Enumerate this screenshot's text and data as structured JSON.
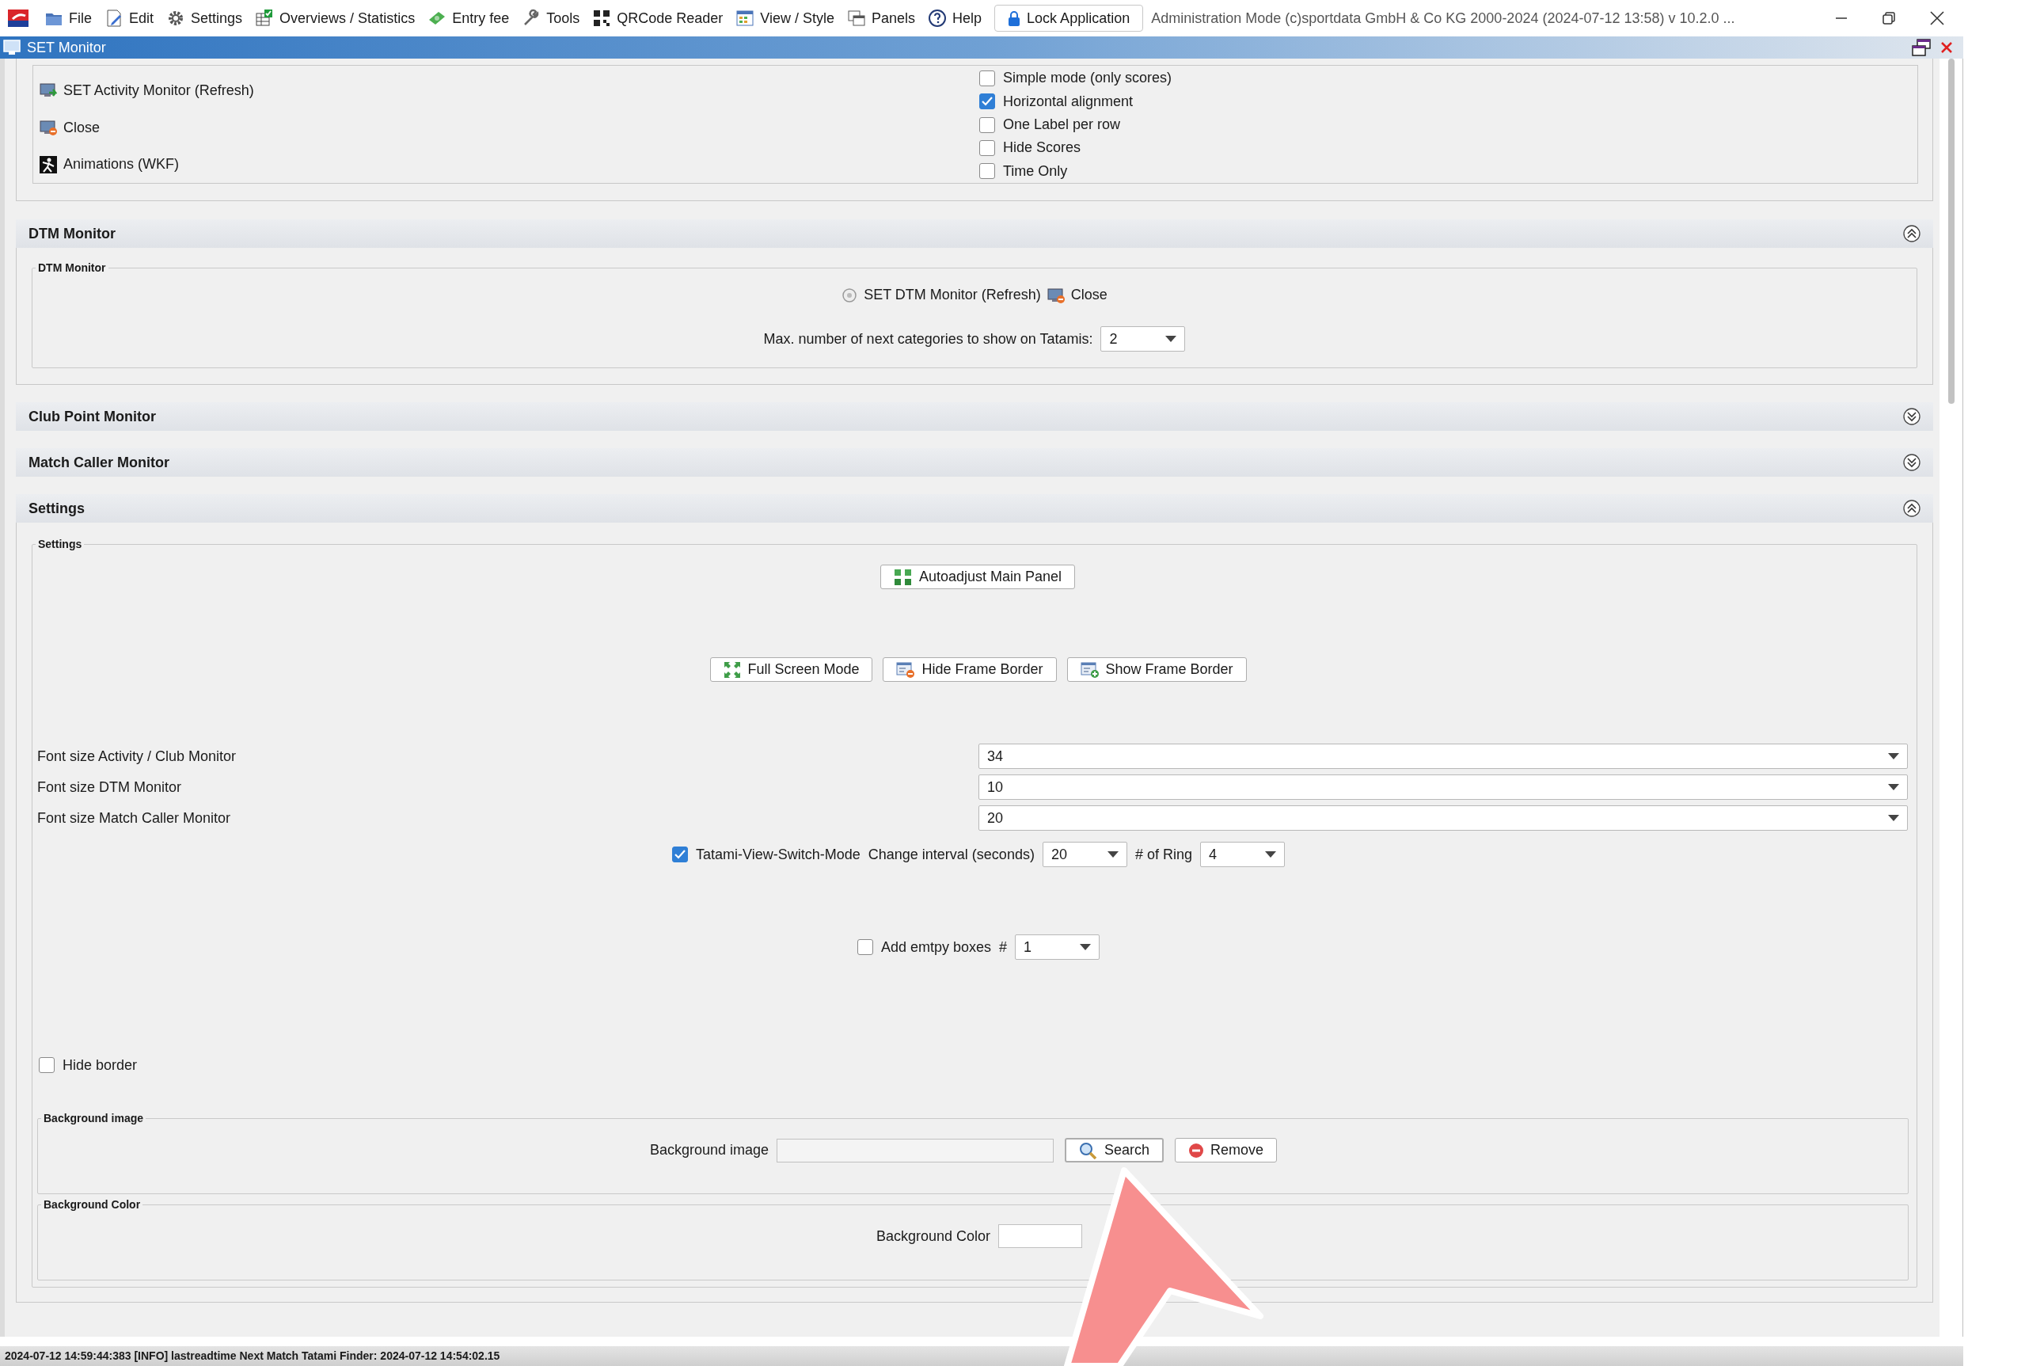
{
  "menu_bar": {
    "items": [
      {
        "label": "File"
      },
      {
        "label": "Edit"
      },
      {
        "label": "Settings"
      },
      {
        "label": "Overviews / Statistics"
      },
      {
        "label": "Entry fee"
      },
      {
        "label": "Tools"
      },
      {
        "label": "QRCode Reader"
      },
      {
        "label": "View / Style"
      },
      {
        "label": "Panels"
      },
      {
        "label": "Help"
      }
    ],
    "lock_button": "Lock Application",
    "title": "Administration Mode (c)sportdata GmbH & Co KG 2000-2024 (2024-07-12 13:58) v 10.2.0 ..."
  },
  "window": {
    "title": "SET Monitor"
  },
  "top_panel": {
    "actions": [
      {
        "label": "SET Activity Monitor (Refresh)"
      },
      {
        "label": "Close"
      },
      {
        "label": "Animations (WKF)"
      }
    ],
    "options": [
      {
        "label": "Simple mode (only scores)",
        "checked": false
      },
      {
        "label": "Horizontal alignment",
        "checked": true
      },
      {
        "label": "One Label per row",
        "checked": false
      },
      {
        "label": "Hide Scores",
        "checked": false
      },
      {
        "label": "Time Only",
        "checked": false
      }
    ]
  },
  "sections": [
    {
      "kind": "dtm",
      "title": "DTM Monitor",
      "expanded": true,
      "group_title": "DTM Monitor",
      "buttons": [
        "SET DTM Monitor (Refresh)",
        "Close"
      ],
      "categories_label": "Max. number of next categories to show on Tatamis:",
      "categories_value": "2"
    },
    {
      "title": "Club Point Monitor",
      "expanded": false
    },
    {
      "title": "Match Caller Monitor",
      "expanded": false
    },
    {
      "kind": "settings",
      "title": "Settings",
      "expanded": true,
      "group_title": "Settings",
      "autoadjust": "Autoadjust Main Panel",
      "frame_buttons": [
        "Full Screen Mode",
        "Hide Frame Border",
        "Show Frame Border"
      ],
      "font_sizes": [
        {
          "label": "Font size Activity / Club Monitor",
          "value": "34"
        },
        {
          "label": "Font size DTM Monitor",
          "value": "10"
        },
        {
          "label": "Font size Match Caller Monitor",
          "value": "20"
        }
      ],
      "tatami": {
        "label": "Tatami-View-Switch-Mode",
        "checked": true,
        "interval_label": "Change interval (seconds)",
        "interval_value": "20",
        "ring_label": "# of Ring",
        "ring_value": "4"
      },
      "empty_boxes": {
        "label": "Add emtpy boxes",
        "checked": false,
        "hash": "#",
        "value": "1"
      },
      "hide_border": {
        "label": "Hide border",
        "checked": false
      },
      "background_image": {
        "group_title": "Background image",
        "label": "Background image",
        "search": "Search",
        "remove": "Remove"
      },
      "background_color": {
        "group_title": "Background Color",
        "label": "Background Color"
      }
    }
  ],
  "status_bar": {
    "text": "2024-07-12 14:59:44:383 [INFO] lastreadtime Next Match Tatami Finder: 2024-07-12 14:54:02.15"
  }
}
